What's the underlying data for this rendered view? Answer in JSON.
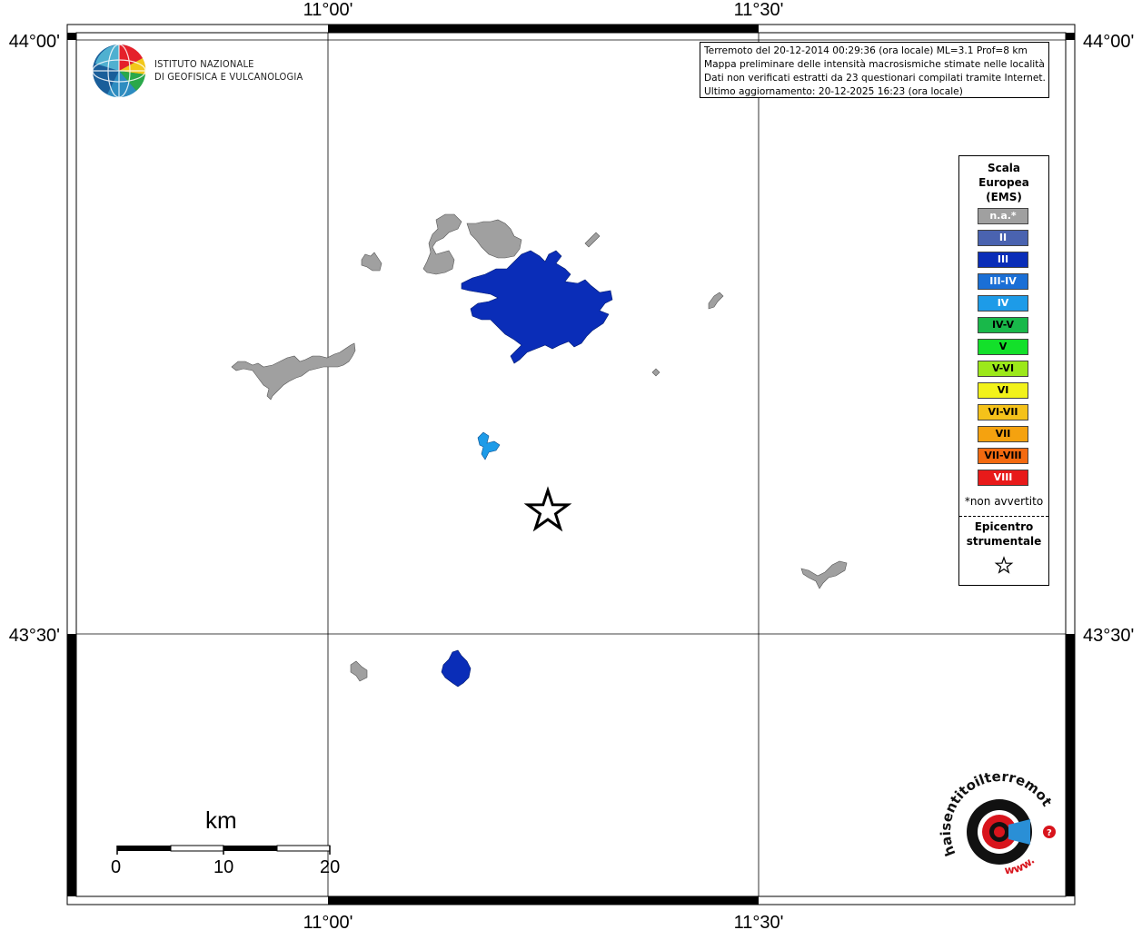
{
  "institute": {
    "line1": "ISTITUTO NAZIONALE",
    "line2": "DI GEOFISICA E VULCANOLOGIA"
  },
  "info": {
    "line1": "Terremoto del 20-12-2014 00:29:36 (ora locale) ML=3.1 Prof=8 km",
    "line2": "Mappa preliminare delle intensità macrosismiche stimate nelle località",
    "line3": "Dati non verificati estratti da 23 questionari compilati tramite Internet.",
    "line4": "Ultimo aggiornamento: 20-12-2025 16:23 (ora locale)"
  },
  "axes": {
    "lon_top": [
      "11°00'",
      "11°30'"
    ],
    "lon_bottom": [
      "11°00'",
      "11°30'"
    ],
    "lat_left": [
      "44°00'",
      "43°30'"
    ],
    "lat_right": [
      "44°00'",
      "43°30'"
    ]
  },
  "legend": {
    "title1": "Scala",
    "title2": "Europea",
    "title3": "(EMS)",
    "items": [
      {
        "label": "n.a.*",
        "color": "#a0a0a0"
      },
      {
        "label": "II",
        "color": "#4a63b0"
      },
      {
        "label": "III",
        "color": "#0a2db8"
      },
      {
        "label": "III-IV",
        "color": "#1a6fd6"
      },
      {
        "label": "IV",
        "color": "#1d9be8"
      },
      {
        "label": "IV-V",
        "color": "#19b84a"
      },
      {
        "label": "V",
        "color": "#13e02a"
      },
      {
        "label": "V-VI",
        "color": "#9ce81a"
      },
      {
        "label": "VI",
        "color": "#f2f21a"
      },
      {
        "label": "VI-VII",
        "color": "#f5c21a"
      },
      {
        "label": "VII",
        "color": "#f5a20f"
      },
      {
        "label": "VII-VIII",
        "color": "#f36a10"
      },
      {
        "label": "VIII",
        "color": "#e81a1a"
      }
    ],
    "note": "*non avvertito",
    "epicentre1": "Epicentro",
    "epicentre2": "strumentale",
    "epicentre_icon": "star-icon"
  },
  "scale_bar": {
    "unit": "km",
    "labels": [
      "0",
      "10",
      "20"
    ]
  },
  "watermark": {
    "text": "haisentitoilterremoto.it",
    "www": "www."
  },
  "map_features": {
    "epicentre_icon": "star-icon",
    "region_colors": {
      "na": "#a0a0a0",
      "iii": "#0a2db8",
      "iv": "#1d9be8"
    }
  }
}
